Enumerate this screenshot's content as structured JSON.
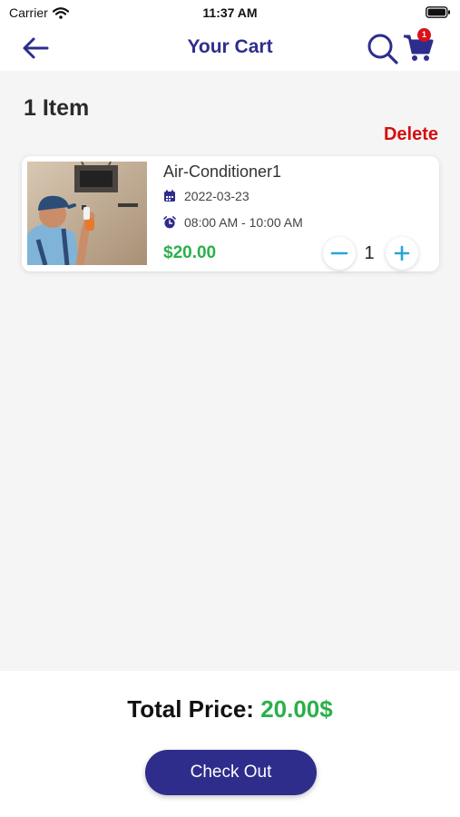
{
  "status_bar": {
    "carrier": "Carrier",
    "time": "11:37 AM"
  },
  "header": {
    "title": "Your Cart",
    "cart_badge": "1",
    "icons": [
      "back-arrow-icon",
      "search-icon",
      "cart-icon"
    ]
  },
  "cart": {
    "item_count_label": "1 Item",
    "delete_label": "Delete",
    "items": [
      {
        "name": "Air-Conditioner1",
        "date": "2022-03-23",
        "time_slot": "08:00 AM - 10:00 AM",
        "price": "$20.00",
        "quantity": "1"
      }
    ]
  },
  "footer": {
    "total_label": "Total Price:",
    "total_value": "20.00$",
    "checkout_label": "Check Out"
  },
  "colors": {
    "primary": "#2e2d8c",
    "price_green": "#2bb04a",
    "delete_red": "#d40f0f",
    "badge_red": "#d9121a",
    "stepper_accent": "#2aa5d8"
  }
}
